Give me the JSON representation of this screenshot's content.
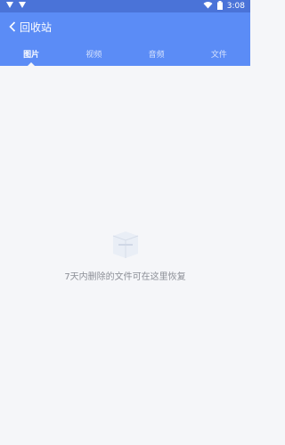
{
  "status": {
    "time": "3:08"
  },
  "header": {
    "title": "回收站"
  },
  "tabs": [
    {
      "label": "图片",
      "active": true
    },
    {
      "label": "视频",
      "active": false
    },
    {
      "label": "音频",
      "active": false
    },
    {
      "label": "文件",
      "active": false
    }
  ],
  "empty_state": {
    "message": "7天内删除的文件可在这里恢复"
  }
}
